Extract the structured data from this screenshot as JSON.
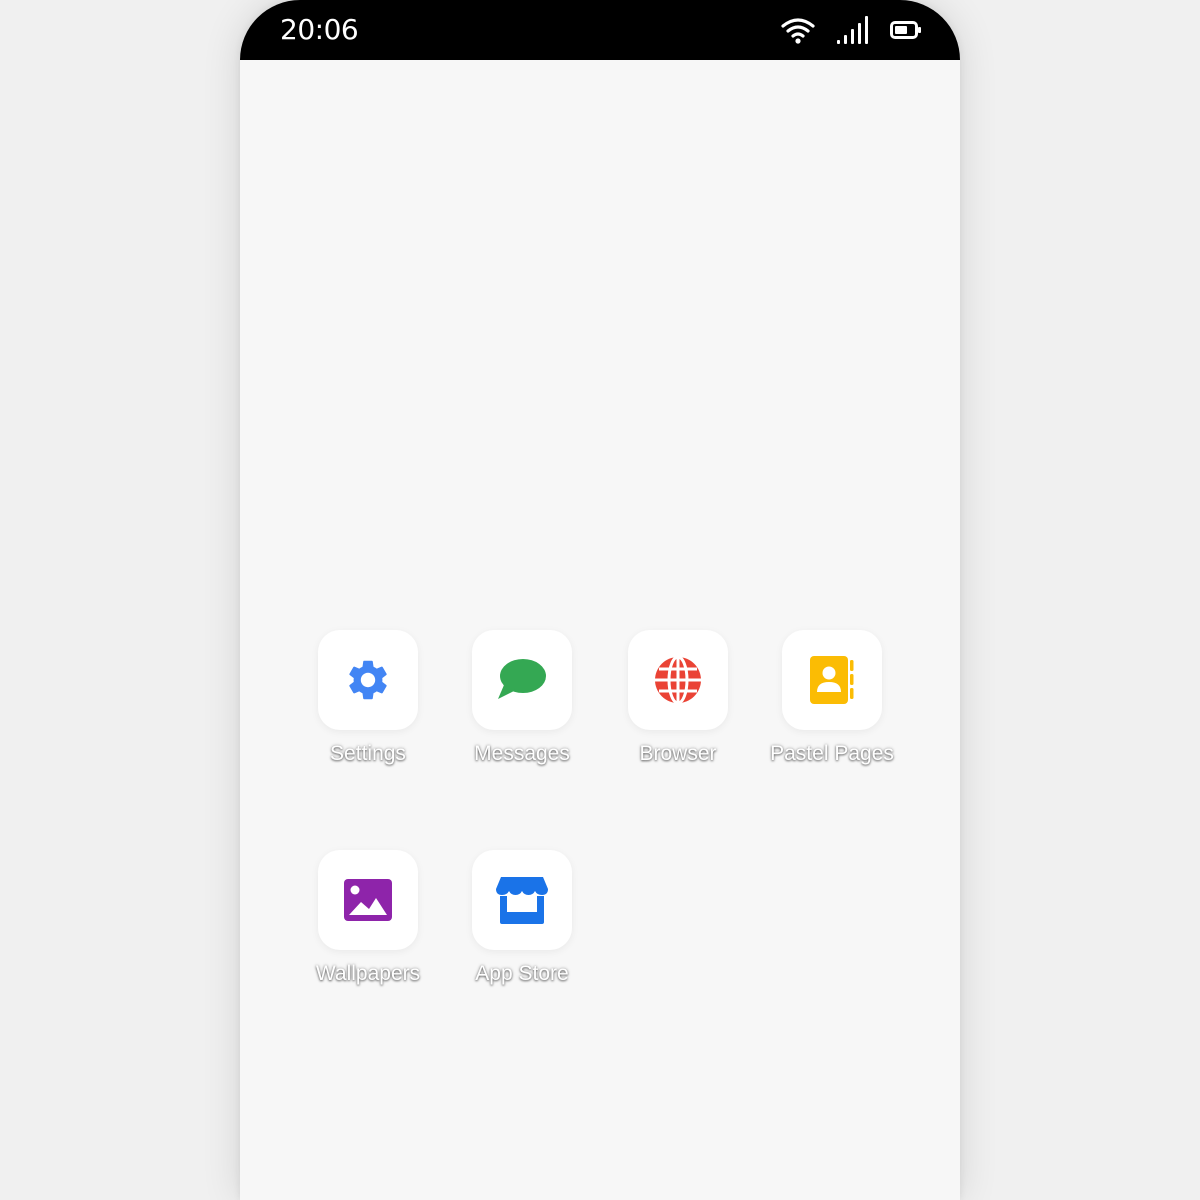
{
  "status_bar": {
    "time": "20:06",
    "icons": [
      "wifi-icon",
      "cellular-signal-icon",
      "battery-icon"
    ]
  },
  "apps": [
    {
      "label": "Settings",
      "icon": "gear-icon",
      "color": "#4285F4"
    },
    {
      "label": "Messages",
      "icon": "chat-bubble-icon",
      "color": "#34A853"
    },
    {
      "label": "Browser",
      "icon": "globe-icon",
      "color": "#EA4335"
    },
    {
      "label": "Pastel Pages",
      "icon": "contacts-book-icon",
      "color": "#FBBC04"
    },
    {
      "label": "Wallpapers",
      "icon": "image-icon",
      "color": "#8E24AA"
    },
    {
      "label": "App Store",
      "icon": "storefront-icon",
      "color": "#1A73E8"
    }
  ]
}
